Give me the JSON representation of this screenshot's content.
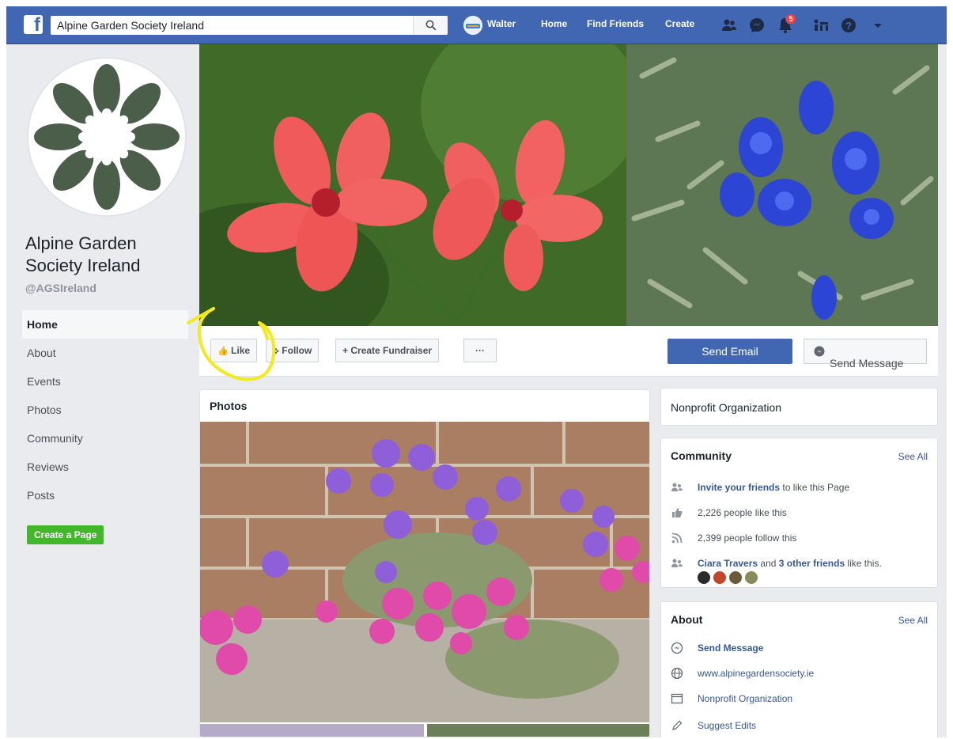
{
  "search": {
    "value": "Alpine Garden Society Ireland"
  },
  "topnav": {
    "profile_name": "Walter",
    "home": "Home",
    "find_friends": "Find Friends",
    "create": "Create",
    "notification_count": "5"
  },
  "page": {
    "name": "Alpine Garden Society Ireland",
    "handle": "@AGSIreland"
  },
  "sidebar": {
    "items": [
      {
        "label": "Home"
      },
      {
        "label": "About"
      },
      {
        "label": "Events"
      },
      {
        "label": "Photos"
      },
      {
        "label": "Community"
      },
      {
        "label": "Reviews"
      },
      {
        "label": "Posts"
      }
    ],
    "create_page": "Create a Page"
  },
  "actions": {
    "like": "Like",
    "follow": "Follow",
    "create_fundraiser": "Create Fundraiser",
    "more": "···",
    "send_email": "Send Email",
    "send_message": "Send Message"
  },
  "photos": {
    "title": "Photos"
  },
  "category_card": {
    "label": "Nonprofit Organization"
  },
  "community": {
    "title": "Community",
    "see_all": "See All",
    "invite_link": "Invite your friends",
    "invite_rest": " to like this Page",
    "likes": "2,226 people like this",
    "follows": "2,399 people follow this",
    "friend_name": "Ciara Travers",
    "friends_mid": " and ",
    "other_friends": "3 other friends",
    "friends_tail": " like this."
  },
  "about": {
    "title": "About",
    "see_all": "See All",
    "send_message": "Send Message",
    "website": "www.alpinegardensociety.ie",
    "category": "Nonprofit Organization",
    "suggest_edits": "Suggest Edits"
  },
  "colors": {
    "fb_blue": "#4267b2",
    "link_blue": "#365899",
    "green": "#42b72a",
    "annotation_yellow": "#f2ea1c",
    "logo_green": "#4a5e4a"
  }
}
